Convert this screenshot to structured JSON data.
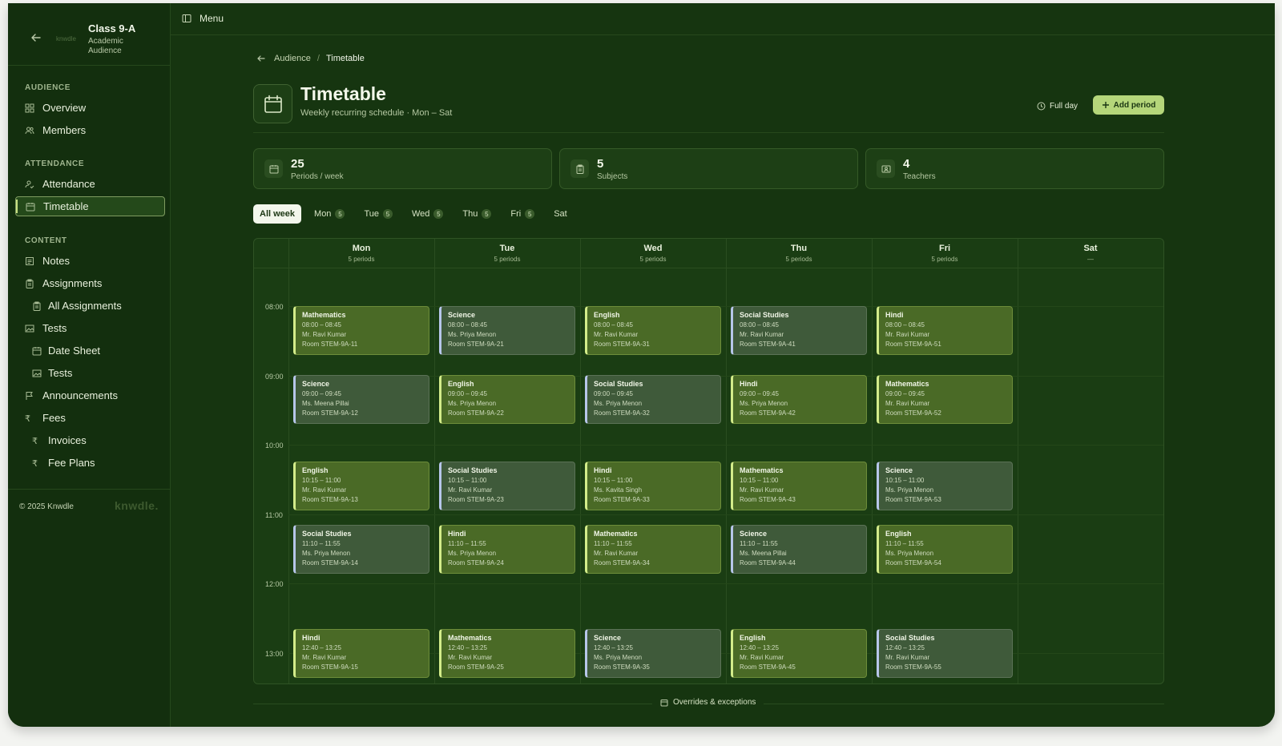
{
  "sidebar": {
    "title": "Class 9-A",
    "subtitle_line1": "Academic",
    "subtitle_line2": "Audience",
    "logo_text": "knwdle",
    "sections": {
      "audience": "AUDIENCE",
      "attendance": "ATTENDANCE",
      "content": "CONTENT"
    },
    "items": {
      "overview": "Overview",
      "members": "Members",
      "attendance": "Attendance",
      "timetable": "Timetable",
      "notes": "Notes",
      "assignments": "Assignments",
      "all_assignments": "All Assignments",
      "tests": "Tests",
      "date_sheet": "Date Sheet",
      "tests_sub": "Tests",
      "announcements": "Announcements",
      "fees": "Fees",
      "invoices": "Invoices",
      "fee_plans": "Fee Plans"
    },
    "footer_copy": "© 2025 Knwdle",
    "footer_brand": "knwdle."
  },
  "topbar": {
    "menu_label": "Menu"
  },
  "breadcrumb": {
    "parent": "Audience",
    "separator": "/",
    "current": "Timetable"
  },
  "header": {
    "title": "Timetable",
    "subtitle": "Weekly recurring schedule · Mon – Sat",
    "full_day_label": "Full day",
    "add_period_label": "Add period"
  },
  "stats": [
    {
      "value": "25",
      "caption": "Periods / week"
    },
    {
      "value": "5",
      "caption": "Subjects"
    },
    {
      "value": "4",
      "caption": "Teachers"
    }
  ],
  "tabs": [
    {
      "label": "All week",
      "count": ""
    },
    {
      "label": "Mon",
      "count": "5"
    },
    {
      "label": "Tue",
      "count": "5"
    },
    {
      "label": "Wed",
      "count": "5"
    },
    {
      "label": "Thu",
      "count": "5"
    },
    {
      "label": "Fri",
      "count": "5"
    },
    {
      "label": "Sat",
      "count": ""
    }
  ],
  "hours": [
    "08:00",
    "09:00",
    "10:00",
    "11:00",
    "12:00",
    "13:00"
  ],
  "days": [
    {
      "name": "Mon",
      "periods_label": "5 periods"
    },
    {
      "name": "Tue",
      "periods_label": "5 periods"
    },
    {
      "name": "Wed",
      "periods_label": "5 periods"
    },
    {
      "name": "Thu",
      "periods_label": "5 periods"
    },
    {
      "name": "Fri",
      "periods_label": "5 periods"
    },
    {
      "name": "Sat",
      "periods_label": "—"
    }
  ],
  "slots": [
    "08:00 – 08:45",
    "09:00 – 09:45",
    "10:15 – 11:00",
    "11:10 – 11:55",
    "12:40 – 13:25"
  ],
  "schedule": [
    [
      {
        "subject": "Mathematics",
        "time": "08:00 – 08:45",
        "teacher": "Mr. Ravi Kumar",
        "room": "Room STEM-9A-11",
        "style": "hl"
      },
      {
        "subject": "Science",
        "time": "09:00 – 09:45",
        "teacher": "Ms. Meena Pillai",
        "room": "Room STEM-9A-12",
        "style": "dk"
      },
      {
        "subject": "English",
        "time": "10:15 – 11:00",
        "teacher": "Mr. Ravi Kumar",
        "room": "Room STEM-9A-13",
        "style": "hl"
      },
      {
        "subject": "Social Studies",
        "time": "11:10 – 11:55",
        "teacher": "Ms. Priya Menon",
        "room": "Room STEM-9A-14",
        "style": "dk"
      },
      {
        "subject": "Hindi",
        "time": "12:40 – 13:25",
        "teacher": "Mr. Ravi Kumar",
        "room": "Room STEM-9A-15",
        "style": "hl"
      }
    ],
    [
      {
        "subject": "Science",
        "time": "08:00 – 08:45",
        "teacher": "Ms. Priya Menon",
        "room": "Room STEM-9A-21",
        "style": "dk"
      },
      {
        "subject": "English",
        "time": "09:00 – 09:45",
        "teacher": "Ms. Priya Menon",
        "room": "Room STEM-9A-22",
        "style": "hl"
      },
      {
        "subject": "Social Studies",
        "time": "10:15 – 11:00",
        "teacher": "Mr. Ravi Kumar",
        "room": "Room STEM-9A-23",
        "style": "dk"
      },
      {
        "subject": "Hindi",
        "time": "11:10 – 11:55",
        "teacher": "Ms. Priya Menon",
        "room": "Room STEM-9A-24",
        "style": "hl"
      },
      {
        "subject": "Mathematics",
        "time": "12:40 – 13:25",
        "teacher": "Mr. Ravi Kumar",
        "room": "Room STEM-9A-25",
        "style": "hl"
      }
    ],
    [
      {
        "subject": "English",
        "time": "08:00 – 08:45",
        "teacher": "Mr. Ravi Kumar",
        "room": "Room STEM-9A-31",
        "style": "hl"
      },
      {
        "subject": "Social Studies",
        "time": "09:00 – 09:45",
        "teacher": "Ms. Priya Menon",
        "room": "Room STEM-9A-32",
        "style": "dk"
      },
      {
        "subject": "Hindi",
        "time": "10:15 – 11:00",
        "teacher": "Ms. Kavita Singh",
        "room": "Room STEM-9A-33",
        "style": "hl"
      },
      {
        "subject": "Mathematics",
        "time": "11:10 – 11:55",
        "teacher": "Mr. Ravi Kumar",
        "room": "Room STEM-9A-34",
        "style": "hl"
      },
      {
        "subject": "Science",
        "time": "12:40 – 13:25",
        "teacher": "Ms. Priya Menon",
        "room": "Room STEM-9A-35",
        "style": "dk"
      }
    ],
    [
      {
        "subject": "Social Studies",
        "time": "08:00 – 08:45",
        "teacher": "Mr. Ravi Kumar",
        "room": "Room STEM-9A-41",
        "style": "dk"
      },
      {
        "subject": "Hindi",
        "time": "09:00 – 09:45",
        "teacher": "Ms. Priya Menon",
        "room": "Room STEM-9A-42",
        "style": "hl"
      },
      {
        "subject": "Mathematics",
        "time": "10:15 – 11:00",
        "teacher": "Mr. Ravi Kumar",
        "room": "Room STEM-9A-43",
        "style": "hl"
      },
      {
        "subject": "Science",
        "time": "11:10 – 11:55",
        "teacher": "Ms. Meena Pillai",
        "room": "Room STEM-9A-44",
        "style": "dk"
      },
      {
        "subject": "English",
        "time": "12:40 – 13:25",
        "teacher": "Mr. Ravi Kumar",
        "room": "Room STEM-9A-45",
        "style": "hl"
      }
    ],
    [
      {
        "subject": "Hindi",
        "time": "08:00 – 08:45",
        "teacher": "Mr. Ravi Kumar",
        "room": "Room STEM-9A-51",
        "style": "hl"
      },
      {
        "subject": "Mathematics",
        "time": "09:00 – 09:45",
        "teacher": "Mr. Ravi Kumar",
        "room": "Room STEM-9A-52",
        "style": "hl"
      },
      {
        "subject": "Science",
        "time": "10:15 – 11:00",
        "teacher": "Ms. Priya Menon",
        "room": "Room STEM-9A-53",
        "style": "dk"
      },
      {
        "subject": "English",
        "time": "11:10 – 11:55",
        "teacher": "Ms. Priya Menon",
        "room": "Room STEM-9A-54",
        "style": "hl"
      },
      {
        "subject": "Social Studies",
        "time": "12:40 – 13:25",
        "teacher": "Mr. Ravi Kumar",
        "room": "Room STEM-9A-55",
        "style": "dk"
      }
    ],
    []
  ],
  "footer": {
    "overrides_label": "Overrides & exceptions"
  },
  "colors": {
    "background": "#163510",
    "accent": "#b5d67a",
    "period_highlight": "#4a6a26",
    "period_muted": "#3f5a3a"
  }
}
